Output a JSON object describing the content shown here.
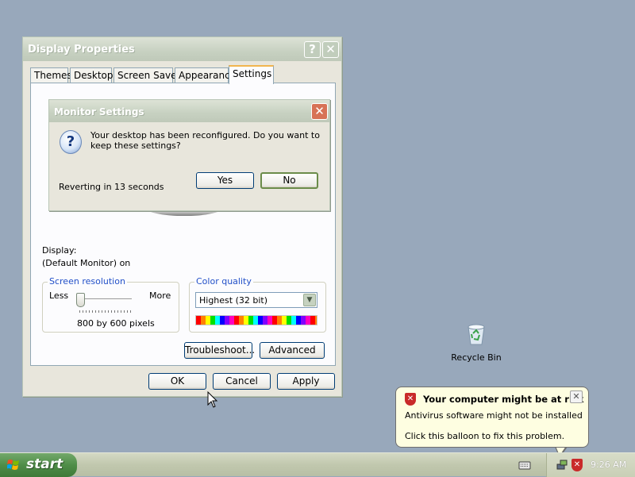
{
  "display_properties": {
    "title": "Display Properties",
    "help_glyph": "?",
    "close_glyph": "✕",
    "tabs": [
      "Themes",
      "Desktop",
      "Screen Saver",
      "Appearance",
      "Settings"
    ],
    "active_tab": "Settings",
    "display_label": "Display:",
    "display_value": "(Default Monitor) on",
    "screen_resolution": {
      "title": "Screen resolution",
      "less_label": "Less",
      "more_label": "More",
      "value": "800 by 600 pixels",
      "slider_level": 0
    },
    "color_quality": {
      "title": "Color quality",
      "selected": "Highest (32 bit)"
    },
    "buttons": {
      "troubleshoot": "Troubleshoot...",
      "advanced": "Advanced",
      "ok": "OK",
      "cancel": "Cancel",
      "apply": "Apply"
    }
  },
  "monitor_settings": {
    "title": "Monitor Settings",
    "close_glyph": "✕",
    "icon": "question-icon",
    "message": "Your desktop has been reconfigured.  Do you want to keep these settings?",
    "countdown": "Reverting in 13 seconds",
    "yes_label": "Yes",
    "no_label": "No"
  },
  "desktop": {
    "recycle_bin_label": "Recycle Bin"
  },
  "balloon": {
    "title": "Your computer might be at risk",
    "line1": "Antivirus software might not be installed",
    "line2": "Click this balloon to fix this problem.",
    "close_glyph": "✕",
    "icon": "security-shield-icon"
  },
  "taskbar": {
    "start_label": "start",
    "clock": "9:26 AM"
  },
  "colors": {
    "desktop_bg": "#98a8bb",
    "taskbar": "#c1c8ae",
    "start_button": "#4f8d48",
    "tab_highlight": "#f1b54f",
    "group_title": "#2250c8",
    "shield_red": "#c92a2a"
  }
}
